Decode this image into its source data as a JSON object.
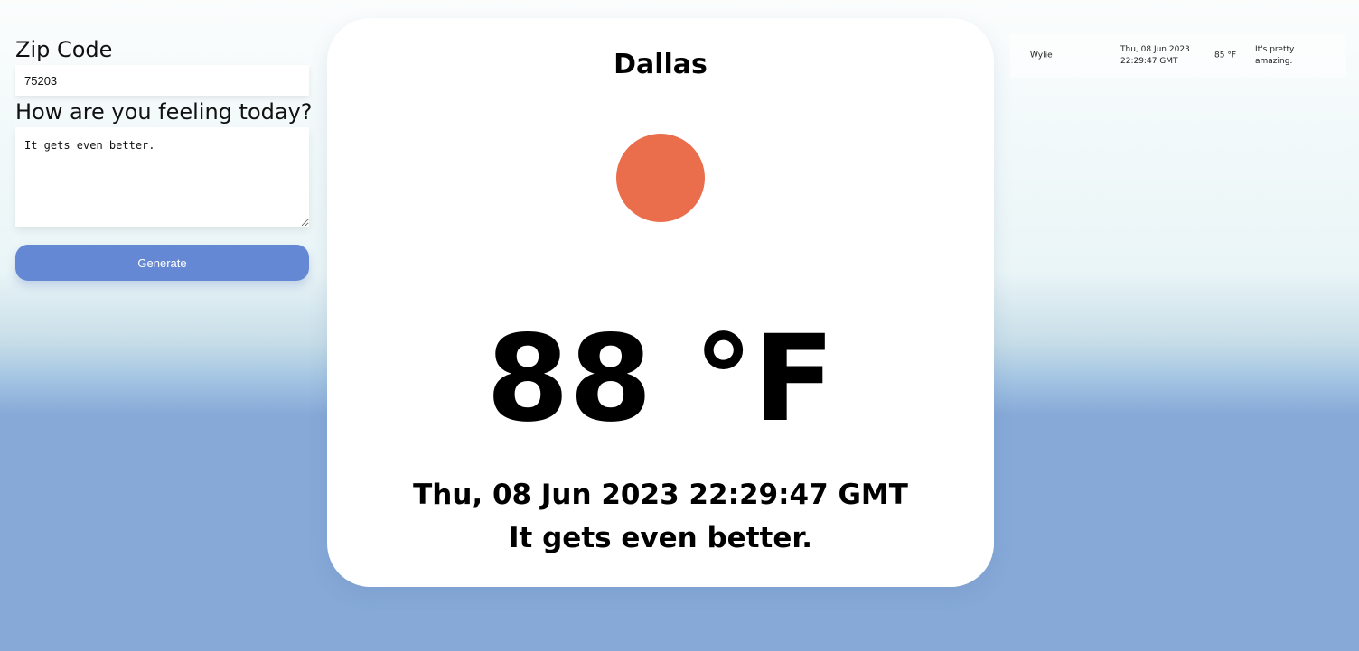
{
  "form": {
    "zip_label": "Zip Code",
    "zip_value": "75203",
    "feeling_label": "How are you feeling today?",
    "feeling_value": "It gets even better.",
    "generate_label": "Generate"
  },
  "card": {
    "city": "Dallas",
    "temperature": "88 °F",
    "date": "Thu, 08 Jun 2023 22:29:47 GMT",
    "feeling": "It gets even better.",
    "icon": "sun-icon"
  },
  "history": {
    "rows": [
      {
        "city": "Wylie",
        "date": "Thu, 08 Jun 2023 22:29:47 GMT",
        "temperature": "85 °F",
        "feeling": "It's pretty amazing."
      }
    ]
  },
  "colors": {
    "accent_button": "#6588d4",
    "sun": "#ea6e4c",
    "background_bottom": "#86a9d8",
    "background_top": "#fbfdfd"
  }
}
